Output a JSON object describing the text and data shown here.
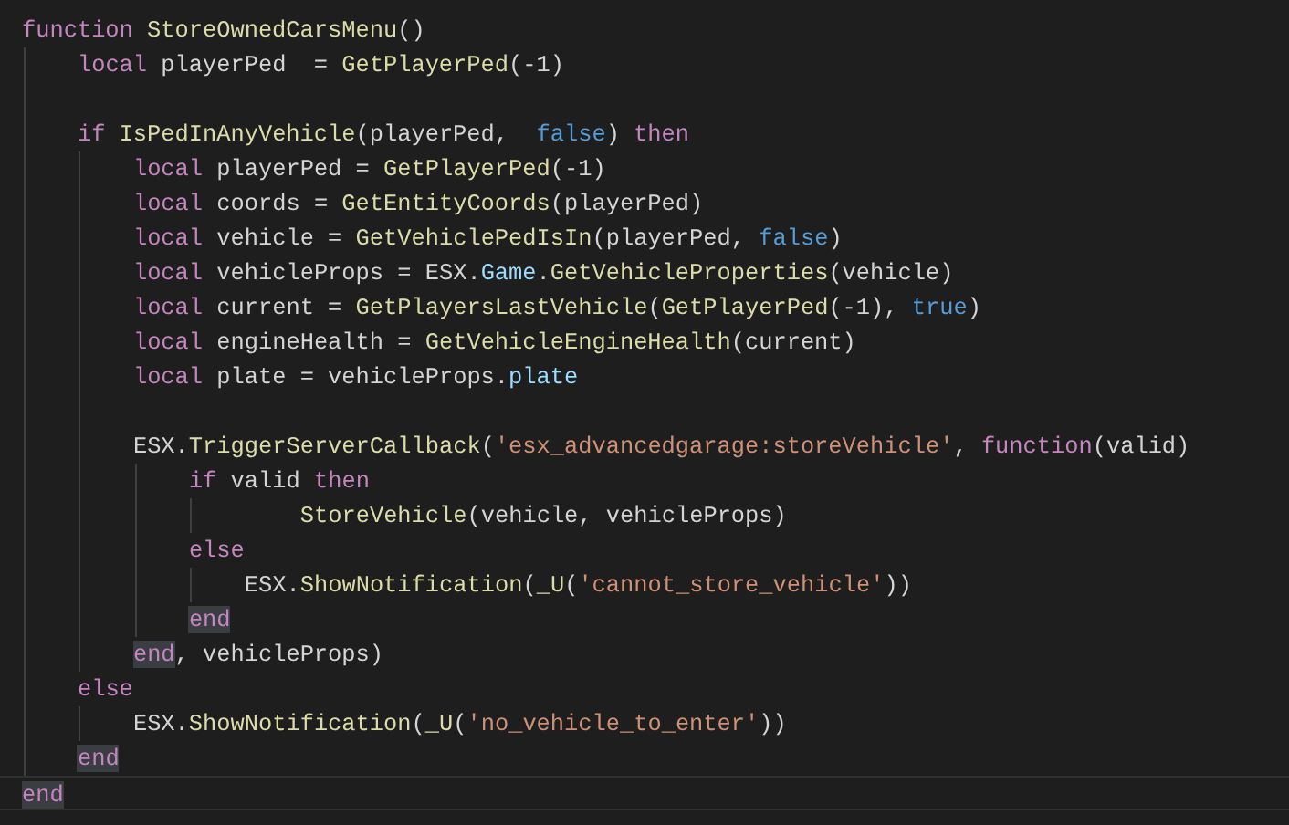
{
  "editor": {
    "lines": [
      {
        "kind": "code",
        "current": false,
        "tokens": [
          {
            "kind": "keyword",
            "text": "function"
          },
          {
            "kind": "function",
            "text": " StoreOwnedCarsMenu"
          },
          {
            "kind": "plain",
            "text": "()"
          }
        ],
        "children": [
          {
            "kind": "code",
            "current": false,
            "tokens": [
              {
                "kind": "keyword",
                "text": "local"
              },
              {
                "kind": "plain",
                "text": " playerPed  = "
              },
              {
                "kind": "function",
                "text": "GetPlayerPed"
              },
              {
                "kind": "plain",
                "text": "(-1)"
              }
            ]
          },
          {
            "kind": "blank",
            "current": false
          },
          {
            "kind": "code",
            "current": false,
            "tokens": [
              {
                "kind": "keyword",
                "text": "if"
              },
              {
                "kind": "function",
                "text": " IsPedInAnyVehicle"
              },
              {
                "kind": "plain",
                "text": "(playerPed,  "
              },
              {
                "kind": "constant",
                "text": "false"
              },
              {
                "kind": "plain",
                "text": ")"
              },
              {
                "kind": "keyword",
                "text": " then"
              }
            ],
            "children": [
              {
                "kind": "code",
                "current": false,
                "tokens": [
                  {
                    "kind": "keyword",
                    "text": "local"
                  },
                  {
                    "kind": "plain",
                    "text": " playerPed = "
                  },
                  {
                    "kind": "function",
                    "text": "GetPlayerPed"
                  },
                  {
                    "kind": "plain",
                    "text": "(-1)"
                  }
                ]
              },
              {
                "kind": "code",
                "current": false,
                "tokens": [
                  {
                    "kind": "keyword",
                    "text": "local"
                  },
                  {
                    "kind": "plain",
                    "text": " coords = "
                  },
                  {
                    "kind": "function",
                    "text": "GetEntityCoords"
                  },
                  {
                    "kind": "plain",
                    "text": "(playerPed)"
                  }
                ]
              },
              {
                "kind": "code",
                "current": false,
                "tokens": [
                  {
                    "kind": "keyword",
                    "text": "local"
                  },
                  {
                    "kind": "plain",
                    "text": " vehicle = "
                  },
                  {
                    "kind": "function",
                    "text": "GetVehiclePedIsIn"
                  },
                  {
                    "kind": "plain",
                    "text": "(playerPed, "
                  },
                  {
                    "kind": "constant",
                    "text": "false"
                  },
                  {
                    "kind": "plain",
                    "text": ")"
                  }
                ]
              },
              {
                "kind": "code",
                "current": false,
                "tokens": [
                  {
                    "kind": "keyword",
                    "text": "local"
                  },
                  {
                    "kind": "plain",
                    "text": " vehicleProps = ESX."
                  },
                  {
                    "kind": "property",
                    "text": "Game"
                  },
                  {
                    "kind": "plain",
                    "text": "."
                  },
                  {
                    "kind": "function",
                    "text": "GetVehicleProperties"
                  },
                  {
                    "kind": "plain",
                    "text": "(vehicle)"
                  }
                ]
              },
              {
                "kind": "code",
                "current": false,
                "tokens": [
                  {
                    "kind": "keyword",
                    "text": "local"
                  },
                  {
                    "kind": "plain",
                    "text": " current = "
                  },
                  {
                    "kind": "function",
                    "text": "GetPlayersLastVehicle"
                  },
                  {
                    "kind": "plain",
                    "text": "("
                  },
                  {
                    "kind": "function",
                    "text": "GetPlayerPed"
                  },
                  {
                    "kind": "plain",
                    "text": "(-1), "
                  },
                  {
                    "kind": "constant",
                    "text": "true"
                  },
                  {
                    "kind": "plain",
                    "text": ")"
                  }
                ]
              },
              {
                "kind": "code",
                "current": false,
                "tokens": [
                  {
                    "kind": "keyword",
                    "text": "local"
                  },
                  {
                    "kind": "plain",
                    "text": " engineHealth = "
                  },
                  {
                    "kind": "function",
                    "text": "GetVehicleEngineHealth"
                  },
                  {
                    "kind": "plain",
                    "text": "(current)"
                  }
                ]
              },
              {
                "kind": "code",
                "current": false,
                "tokens": [
                  {
                    "kind": "keyword",
                    "text": "local"
                  },
                  {
                    "kind": "plain",
                    "text": " plate = vehicleProps."
                  },
                  {
                    "kind": "property",
                    "text": "plate"
                  }
                ]
              },
              {
                "kind": "blank",
                "current": false
              },
              {
                "kind": "code",
                "current": false,
                "tokens": [
                  {
                    "kind": "plain",
                    "text": "ESX."
                  },
                  {
                    "kind": "function",
                    "text": "TriggerServerCallback"
                  },
                  {
                    "kind": "plain",
                    "text": "("
                  },
                  {
                    "kind": "string",
                    "text": "'esx_advancedgarage:storeVehicle'"
                  },
                  {
                    "kind": "plain",
                    "text": ","
                  },
                  {
                    "kind": "keyword",
                    "text": " function"
                  },
                  {
                    "kind": "plain",
                    "text": "(valid)"
                  }
                ],
                "children": [
                  {
                    "kind": "code",
                    "current": false,
                    "tokens": [
                      {
                        "kind": "keyword",
                        "text": "if"
                      },
                      {
                        "kind": "plain",
                        "text": " valid"
                      },
                      {
                        "kind": "keyword",
                        "text": " then"
                      }
                    ],
                    "children": [
                      {
                        "kind": "code",
                        "current": false,
                        "wide_indent": true,
                        "tokens": [
                          {
                            "kind": "function",
                            "text": "StoreVehicle"
                          },
                          {
                            "kind": "plain",
                            "text": "(vehicle, vehicleProps)"
                          }
                        ]
                      }
                    ]
                  },
                  {
                    "kind": "code",
                    "current": false,
                    "tokens": [
                      {
                        "kind": "keyword",
                        "text": "else"
                      }
                    ],
                    "children": [
                      {
                        "kind": "code",
                        "current": false,
                        "tokens": [
                          {
                            "kind": "plain",
                            "text": "ESX."
                          },
                          {
                            "kind": "function",
                            "text": "ShowNotification"
                          },
                          {
                            "kind": "plain",
                            "text": "("
                          },
                          {
                            "kind": "function",
                            "text": "_U"
                          },
                          {
                            "kind": "plain",
                            "text": "("
                          },
                          {
                            "kind": "string",
                            "text": "'cannot_store_vehicle'"
                          },
                          {
                            "kind": "plain",
                            "text": "))"
                          }
                        ]
                      }
                    ]
                  },
                  {
                    "kind": "code",
                    "current": false,
                    "tokens": [
                      {
                        "kind": "keyword",
                        "text": "end",
                        "highlighted": true
                      }
                    ]
                  }
                ]
              },
              {
                "kind": "code",
                "current": false,
                "tokens": [
                  {
                    "kind": "keyword",
                    "text": "end",
                    "highlighted": true
                  },
                  {
                    "kind": "plain",
                    "text": ", vehicleProps)"
                  }
                ]
              }
            ]
          },
          {
            "kind": "code",
            "current": false,
            "tokens": [
              {
                "kind": "keyword",
                "text": "else"
              }
            ],
            "children": [
              {
                "kind": "code",
                "current": false,
                "tokens": [
                  {
                    "kind": "plain",
                    "text": "ESX."
                  },
                  {
                    "kind": "function",
                    "text": "ShowNotification"
                  },
                  {
                    "kind": "plain",
                    "text": "("
                  },
                  {
                    "kind": "function",
                    "text": "_U"
                  },
                  {
                    "kind": "plain",
                    "text": "("
                  },
                  {
                    "kind": "string",
                    "text": "'no_vehicle_to_enter'"
                  },
                  {
                    "kind": "plain",
                    "text": "))"
                  }
                ]
              }
            ]
          },
          {
            "kind": "code",
            "current": false,
            "tokens": [
              {
                "kind": "keyword",
                "text": "end",
                "highlighted": true
              }
            ]
          }
        ]
      },
      {
        "kind": "code",
        "current": true,
        "tokens": [
          {
            "kind": "keyword",
            "text": "end",
            "highlighted": true
          }
        ]
      }
    ]
  }
}
